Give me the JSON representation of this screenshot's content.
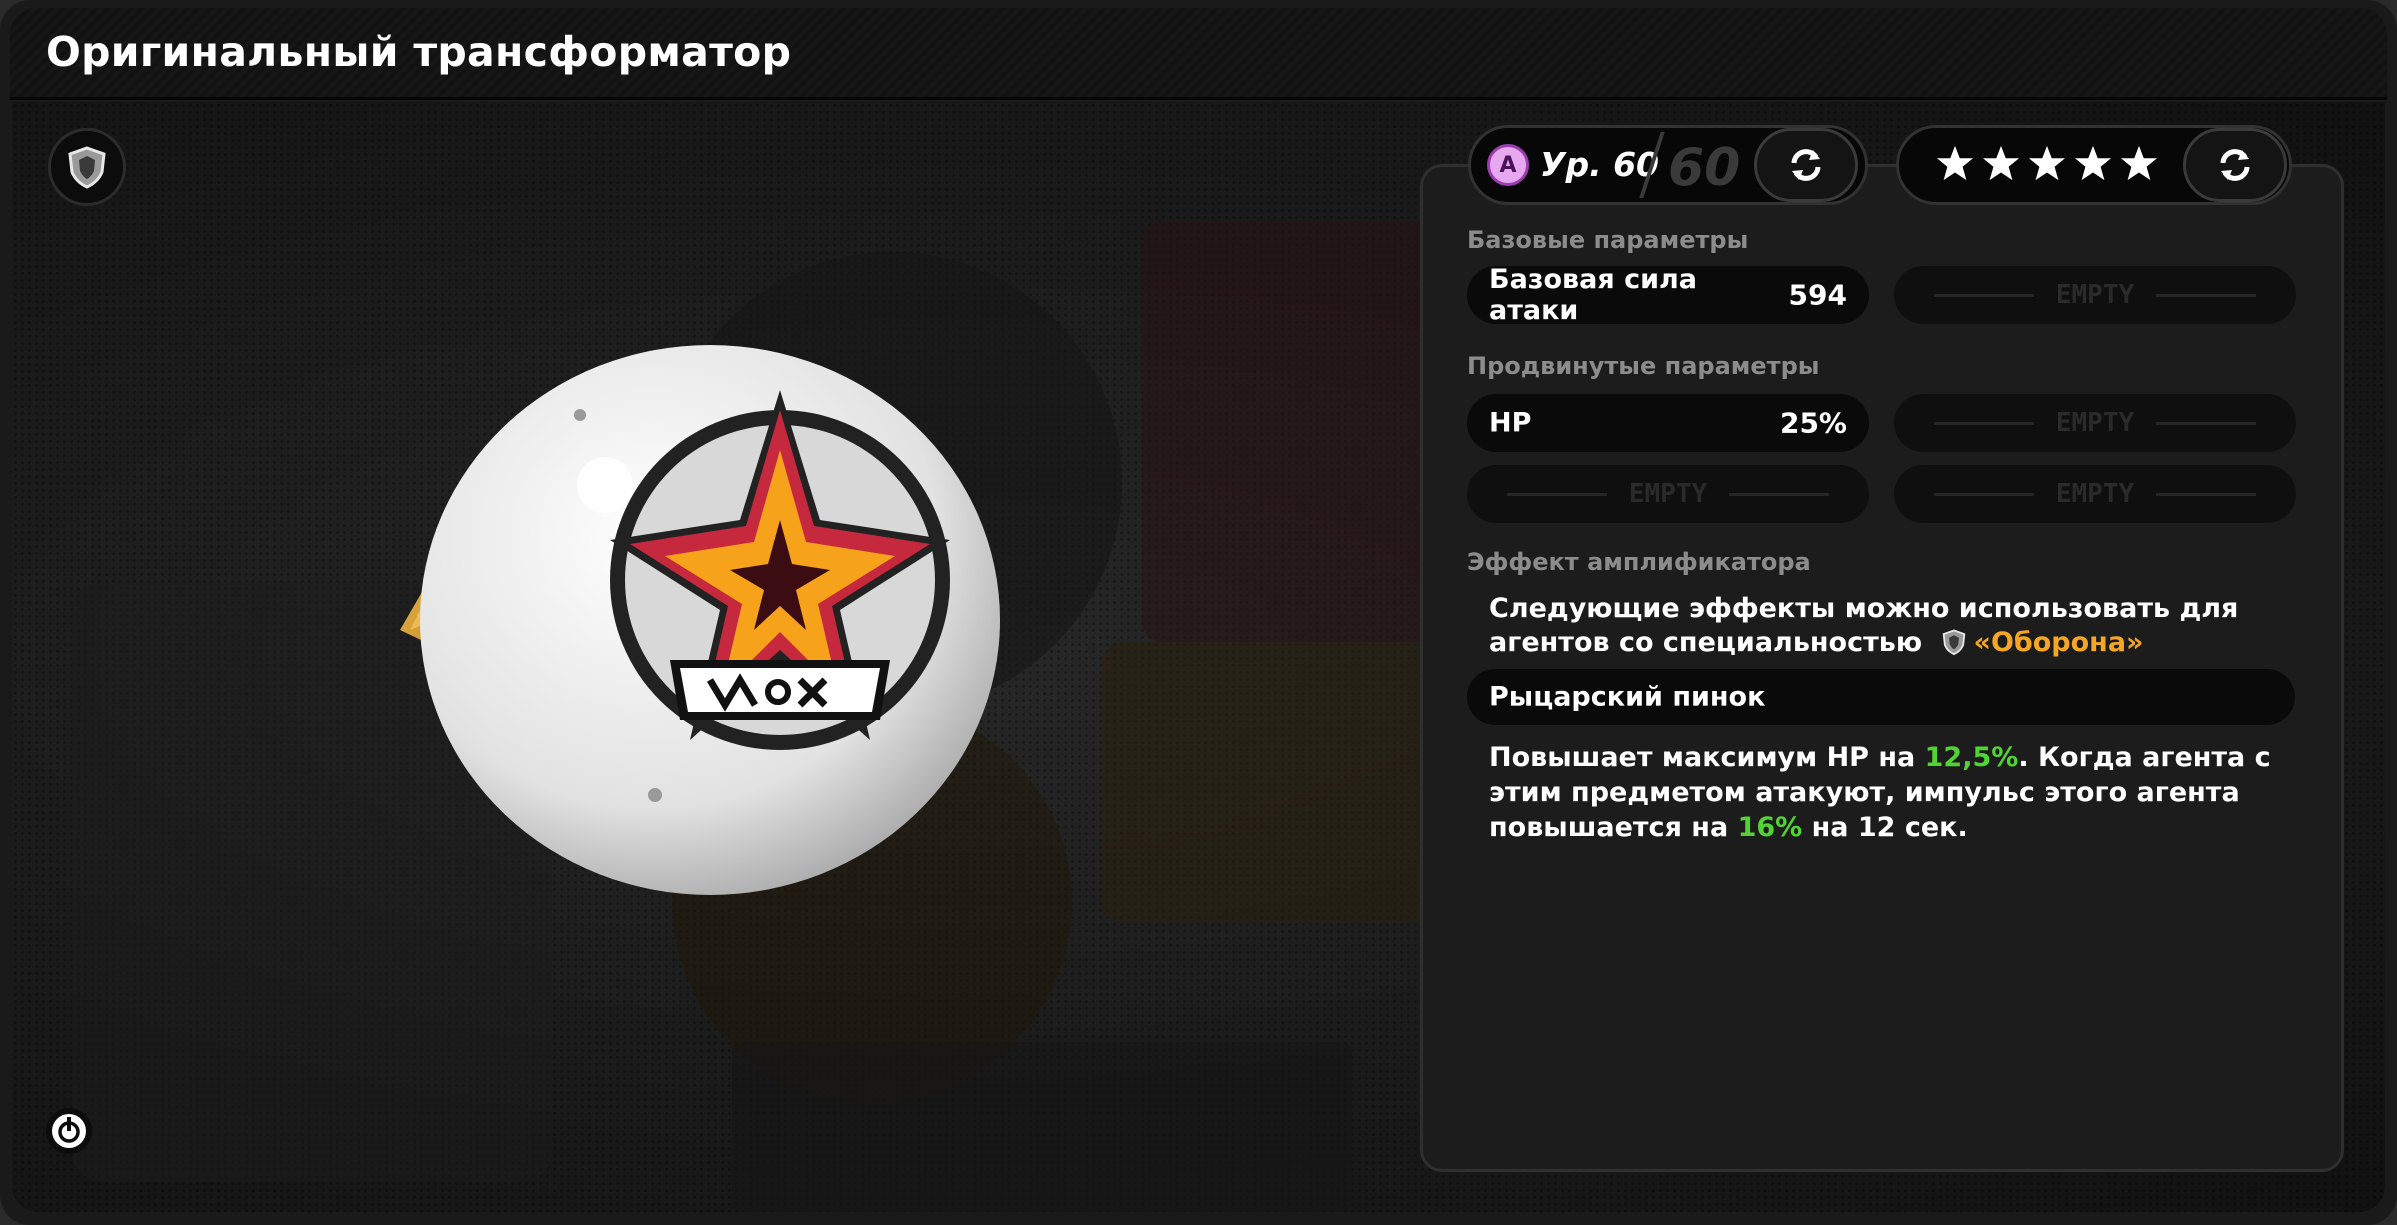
{
  "window": {
    "title": "Оригинальный трансформатор"
  },
  "level": {
    "rank_letter": "A",
    "current": "Ур. 60",
    "max": "60"
  },
  "stars": {
    "count": 5
  },
  "base_params": {
    "label": "Базовые параметры",
    "main_stat_name": "Базовая сила атаки",
    "main_stat_value": "594",
    "slot_empty": "EMPTY"
  },
  "advanced_params": {
    "label": "Продвинутые параметры",
    "stats": [
      {
        "name": "HP",
        "value": "25%"
      }
    ],
    "slot_empty": "EMPTY"
  },
  "amplifier": {
    "label": "Эффект амплификатора",
    "desc_prefix": "Следующие эффекты можно использовать для агентов со специальностью",
    "specialty": "«Оборона»",
    "skill_name": "Рыцарский пинок",
    "skill_text_1": "Повышает максимум HP на ",
    "skill_value_1": "12,5%",
    "skill_text_2": ". Когда агента с этим предметом атакуют, импульс этого агента повышается на ",
    "skill_value_2": "16%",
    "skill_text_3": " на 12 сек."
  },
  "icons": {
    "specialty_button": "shield-icon",
    "bottom_button": "power-icon",
    "refresh": "refresh-icon",
    "star": "star-icon"
  },
  "colors": {
    "accent_orange": "#f5a623",
    "value_green": "#52d334",
    "rank_purple": "#9b3eb0"
  }
}
